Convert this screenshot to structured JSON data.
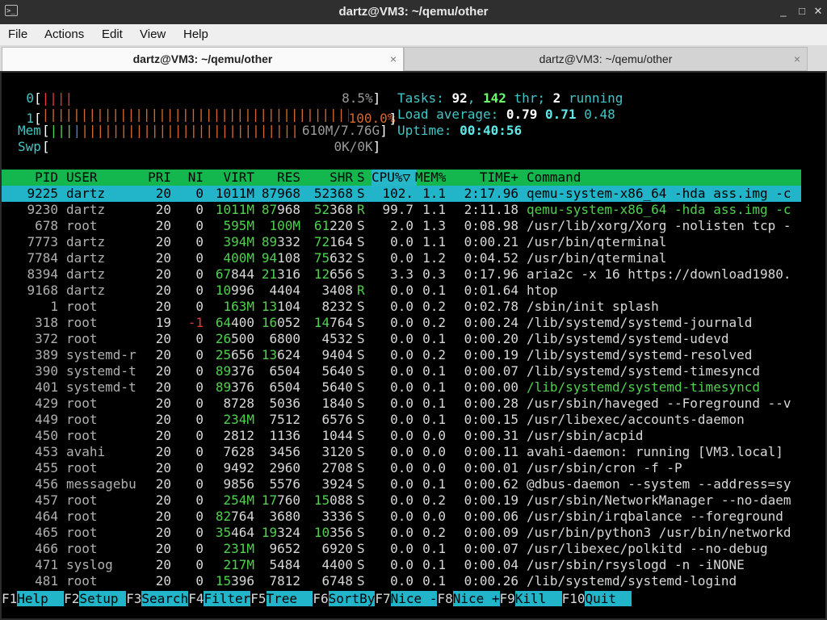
{
  "window": {
    "title": "dartz@VM3: ~/qemu/other",
    "icon_text": ">_",
    "minimize": "_",
    "maximize": "□",
    "close": "✕"
  },
  "menu": [
    "File",
    "Actions",
    "Edit",
    "View",
    "Help"
  ],
  "tabs": [
    {
      "label": "dartz@VM3: ~/qemu/other",
      "active": true
    },
    {
      "label": "dartz@VM3: ~/qemu/other",
      "active": false
    }
  ],
  "tab_close": "×",
  "meters": {
    "cpu0": {
      "label": "0",
      "bars": "||||",
      "value": "8.5%"
    },
    "cpu1": {
      "label": "1",
      "bars": "||||||||||||||||||||||||||||||||||||||||",
      "value": "100.0%"
    },
    "mem": {
      "label": "Mem",
      "bars_green": "|||",
      "bars_blue": "|",
      "bars_orange": "|||||||||||||||||||||||||||||||",
      "value": "610M/7.76G"
    },
    "swp": {
      "label": "Swp",
      "value": "0K/0K"
    }
  },
  "summary": {
    "tasks_label": "Tasks: ",
    "tasks": "92",
    "thr": "142",
    "thr_label": " thr; ",
    "running": "2",
    "running_label": " running",
    "load_label": "Load average: ",
    "load1": "0.79",
    "load5": "0.71",
    "load15": "0.48",
    "uptime_label": "Uptime: ",
    "uptime": "00:40:56"
  },
  "columns": {
    "pid": "PID",
    "user": "USER",
    "pri": "PRI",
    "ni": "NI",
    "virt": "VIRT",
    "res": "RES",
    "shr": "SHR",
    "s": "S",
    "cpu": "CPU%▽",
    "mem": "MEM%",
    "time": "TIME+",
    "command": "Command"
  },
  "processes": [
    {
      "pid": "9225",
      "user": "dartz",
      "pri": "20",
      "ni": "0",
      "virt": "1011M",
      "res": "87968",
      "shr": "52368",
      "s": "S",
      "cpu": "102.",
      "mem": "1.1",
      "time": "2:17.96",
      "command": "qemu-system-x86_64 -hda ass.img -c"
    },
    {
      "pid": "9230",
      "user": "dartz",
      "pri": "20",
      "ni": "0",
      "virt": "1011M",
      "res": "87968",
      "shr": "52368",
      "s": "R",
      "cpu": "99.7",
      "mem": "1.1",
      "time": "2:11.18",
      "command": "qemu-system-x86_64 -hda ass.img -c"
    },
    {
      "pid": "678",
      "user": "root",
      "pri": "20",
      "ni": "0",
      "virt": "595M",
      "res": "100M",
      "shr": "61220",
      "s": "S",
      "cpu": "2.0",
      "mem": "1.3",
      "time": "0:08.98",
      "command": "/usr/lib/xorg/Xorg -nolisten tcp -"
    },
    {
      "pid": "7773",
      "user": "dartz",
      "pri": "20",
      "ni": "0",
      "virt": "394M",
      "res": "89332",
      "shr": "72164",
      "s": "S",
      "cpu": "0.0",
      "mem": "1.1",
      "time": "0:00.21",
      "command": "/usr/bin/qterminal"
    },
    {
      "pid": "7784",
      "user": "dartz",
      "pri": "20",
      "ni": "0",
      "virt": "400M",
      "res": "94108",
      "shr": "75632",
      "s": "S",
      "cpu": "0.0",
      "mem": "1.2",
      "time": "0:04.52",
      "command": "/usr/bin/qterminal"
    },
    {
      "pid": "8394",
      "user": "dartz",
      "pri": "20",
      "ni": "0",
      "virt": "67844",
      "res": "21316",
      "shr": "12656",
      "s": "S",
      "cpu": "3.3",
      "mem": "0.3",
      "time": "0:17.96",
      "command": "aria2c -x 16 https://download1980."
    },
    {
      "pid": "9168",
      "user": "dartz",
      "pri": "20",
      "ni": "0",
      "virt": "10996",
      "res": "4404",
      "shr": "3408",
      "s": "R",
      "cpu": "0.0",
      "mem": "0.1",
      "time": "0:01.64",
      "command": "htop"
    },
    {
      "pid": "1",
      "user": "root",
      "pri": "20",
      "ni": "0",
      "virt": "163M",
      "res": "13104",
      "shr": "8232",
      "s": "S",
      "cpu": "0.0",
      "mem": "0.2",
      "time": "0:02.78",
      "command": "/sbin/init splash"
    },
    {
      "pid": "318",
      "user": "root",
      "pri": "19",
      "ni": "-1",
      "virt": "64400",
      "res": "16052",
      "shr": "14764",
      "s": "S",
      "cpu": "0.0",
      "mem": "0.2",
      "time": "0:00.24",
      "command": "/lib/systemd/systemd-journald"
    },
    {
      "pid": "372",
      "user": "root",
      "pri": "20",
      "ni": "0",
      "virt": "26500",
      "res": "6800",
      "shr": "4532",
      "s": "S",
      "cpu": "0.0",
      "mem": "0.1",
      "time": "0:00.20",
      "command": "/lib/systemd/systemd-udevd"
    },
    {
      "pid": "389",
      "user": "systemd-r",
      "pri": "20",
      "ni": "0",
      "virt": "25656",
      "res": "13624",
      "shr": "9404",
      "s": "S",
      "cpu": "0.0",
      "mem": "0.2",
      "time": "0:00.19",
      "command": "/lib/systemd/systemd-resolved"
    },
    {
      "pid": "390",
      "user": "systemd-t",
      "pri": "20",
      "ni": "0",
      "virt": "89376",
      "res": "6504",
      "shr": "5640",
      "s": "S",
      "cpu": "0.0",
      "mem": "0.1",
      "time": "0:00.07",
      "command": "/lib/systemd/systemd-timesyncd"
    },
    {
      "pid": "401",
      "user": "systemd-t",
      "pri": "20",
      "ni": "0",
      "virt": "89376",
      "res": "6504",
      "shr": "5640",
      "s": "S",
      "cpu": "0.0",
      "mem": "0.1",
      "time": "0:00.00",
      "command": "/lib/systemd/systemd-timesyncd"
    },
    {
      "pid": "429",
      "user": "root",
      "pri": "20",
      "ni": "0",
      "virt": "8728",
      "res": "5036",
      "shr": "1840",
      "s": "S",
      "cpu": "0.0",
      "mem": "0.1",
      "time": "0:00.28",
      "command": "/usr/sbin/haveged --Foreground --v"
    },
    {
      "pid": "449",
      "user": "root",
      "pri": "20",
      "ni": "0",
      "virt": "234M",
      "res": "7512",
      "shr": "6576",
      "s": "S",
      "cpu": "0.0",
      "mem": "0.1",
      "time": "0:00.15",
      "command": "/usr/libexec/accounts-daemon"
    },
    {
      "pid": "450",
      "user": "root",
      "pri": "20",
      "ni": "0",
      "virt": "2812",
      "res": "1136",
      "shr": "1044",
      "s": "S",
      "cpu": "0.0",
      "mem": "0.0",
      "time": "0:00.31",
      "command": "/usr/sbin/acpid"
    },
    {
      "pid": "453",
      "user": "avahi",
      "pri": "20",
      "ni": "0",
      "virt": "7628",
      "res": "3456",
      "shr": "3120",
      "s": "S",
      "cpu": "0.0",
      "mem": "0.0",
      "time": "0:00.11",
      "command": "avahi-daemon: running [VM3.local]"
    },
    {
      "pid": "455",
      "user": "root",
      "pri": "20",
      "ni": "0",
      "virt": "9492",
      "res": "2960",
      "shr": "2708",
      "s": "S",
      "cpu": "0.0",
      "mem": "0.0",
      "time": "0:00.01",
      "command": "/usr/sbin/cron -f -P"
    },
    {
      "pid": "456",
      "user": "messagebu",
      "pri": "20",
      "ni": "0",
      "virt": "9856",
      "res": "5576",
      "shr": "3924",
      "s": "S",
      "cpu": "0.0",
      "mem": "0.1",
      "time": "0:00.62",
      "command": "@dbus-daemon --system --address=sy"
    },
    {
      "pid": "457",
      "user": "root",
      "pri": "20",
      "ni": "0",
      "virt": "254M",
      "res": "17760",
      "shr": "15088",
      "s": "S",
      "cpu": "0.0",
      "mem": "0.2",
      "time": "0:00.19",
      "command": "/usr/sbin/NetworkManager --no-daem"
    },
    {
      "pid": "464",
      "user": "root",
      "pri": "20",
      "ni": "0",
      "virt": "82764",
      "res": "3680",
      "shr": "3336",
      "s": "S",
      "cpu": "0.0",
      "mem": "0.0",
      "time": "0:00.06",
      "command": "/usr/sbin/irqbalance --foreground"
    },
    {
      "pid": "465",
      "user": "root",
      "pri": "20",
      "ni": "0",
      "virt": "35464",
      "res": "19324",
      "shr": "10356",
      "s": "S",
      "cpu": "0.0",
      "mem": "0.2",
      "time": "0:00.09",
      "command": "/usr/bin/python3 /usr/bin/networkd"
    },
    {
      "pid": "466",
      "user": "root",
      "pri": "20",
      "ni": "0",
      "virt": "231M",
      "res": "9652",
      "shr": "6920",
      "s": "S",
      "cpu": "0.0",
      "mem": "0.1",
      "time": "0:00.07",
      "command": "/usr/libexec/polkitd --no-debug"
    },
    {
      "pid": "471",
      "user": "syslog",
      "pri": "20",
      "ni": "0",
      "virt": "217M",
      "res": "5484",
      "shr": "4400",
      "s": "S",
      "cpu": "0.0",
      "mem": "0.1",
      "time": "0:00.04",
      "command": "/usr/sbin/rsyslogd -n -iNONE"
    },
    {
      "pid": "481",
      "user": "root",
      "pri": "20",
      "ni": "0",
      "virt": "15396",
      "res": "7812",
      "shr": "6748",
      "s": "S",
      "cpu": "0.0",
      "mem": "0.1",
      "time": "0:00.26",
      "command": "/lib/systemd/systemd-logind"
    }
  ],
  "fkeys": [
    {
      "key": "F1",
      "label": "Help  "
    },
    {
      "key": "F2",
      "label": "Setup "
    },
    {
      "key": "F3",
      "label": "Search"
    },
    {
      "key": "F4",
      "label": "Filter"
    },
    {
      "key": "F5",
      "label": "Tree  "
    },
    {
      "key": "F6",
      "label": "SortBy"
    },
    {
      "key": "F7",
      "label": "Nice -"
    },
    {
      "key": "F8",
      "label": "Nice +"
    },
    {
      "key": "F9",
      "label": "Kill  "
    },
    {
      "key": "F10",
      "label": "Quit  "
    }
  ],
  "colors": {
    "header_bg": "#13b74d",
    "selected_bg": "#22b4c8",
    "terminal_bg": "#000000"
  }
}
